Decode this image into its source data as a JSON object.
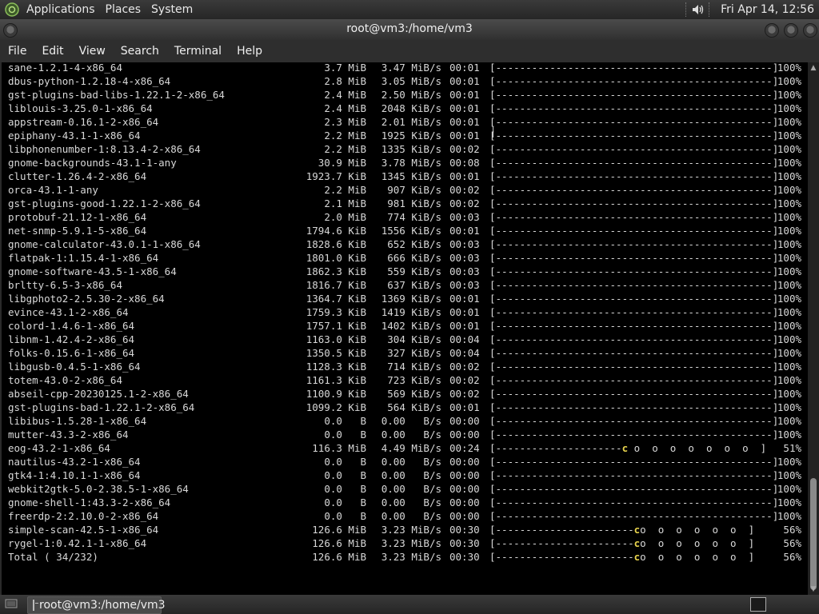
{
  "top_panel": {
    "menus": [
      "Applications",
      "Places",
      "System"
    ],
    "clock": "Fri Apr 14, 12:56"
  },
  "window": {
    "title": "root@vm3:/home/vm3",
    "menu": [
      "File",
      "Edit",
      "View",
      "Search",
      "Terminal",
      "Help"
    ]
  },
  "terminal": {
    "rows": [
      {
        "name": "sane-1.2.1-4-x86_64",
        "size": "3.7 MiB",
        "rate": "3.47 MiB/s",
        "time": "00:01",
        "bar": "[----------------------------------------------]",
        "pct": "100%"
      },
      {
        "name": "dbus-python-1.2.18-4-x86_64",
        "size": "2.8 MiB",
        "rate": "3.05 MiB/s",
        "time": "00:01",
        "bar": "[----------------------------------------------]",
        "pct": "100%"
      },
      {
        "name": "gst-plugins-bad-libs-1.22.1-2-x86_64",
        "size": "2.4 MiB",
        "rate": "2.50 MiB/s",
        "time": "00:01",
        "bar": "[----------------------------------------------]",
        "pct": "100%"
      },
      {
        "name": "liblouis-3.25.0-1-x86_64",
        "size": "2.4 MiB",
        "rate": "2048 KiB/s",
        "time": "00:01",
        "bar": "[----------------------------------------------]",
        "pct": "100%"
      },
      {
        "name": "appstream-0.16.1-2-x86_64",
        "size": "2.3 MiB",
        "rate": "2.01 MiB/s",
        "time": "00:01",
        "bar": "[----------------------------------------------]",
        "pct": "100%"
      },
      {
        "name": "epiphany-43.1-1-x86_64",
        "size": "2.2 MiB",
        "rate": "1925 KiB/s",
        "time": "00:01",
        "bar": "[----------------------------------------------]",
        "pct": "100%"
      },
      {
        "name": "libphonenumber-1:8.13.4-2-x86_64",
        "size": "2.2 MiB",
        "rate": "1335 KiB/s",
        "time": "00:02",
        "bar": "[----------------------------------------------]",
        "pct": "100%"
      },
      {
        "name": "gnome-backgrounds-43.1-1-any",
        "size": "30.9 MiB",
        "rate": "3.78 MiB/s",
        "time": "00:08",
        "bar": "[----------------------------------------------]",
        "pct": "100%"
      },
      {
        "name": "clutter-1.26.4-2-x86_64",
        "size": "1923.7 KiB",
        "rate": "1345 KiB/s",
        "time": "00:01",
        "bar": "[----------------------------------------------]",
        "pct": "100%"
      },
      {
        "name": "orca-43.1-1-any",
        "size": "2.2 MiB",
        "rate": "907 KiB/s",
        "time": "00:02",
        "bar": "[----------------------------------------------]",
        "pct": "100%"
      },
      {
        "name": "gst-plugins-good-1.22.1-2-x86_64",
        "size": "2.1 MiB",
        "rate": "981 KiB/s",
        "time": "00:02",
        "bar": "[----------------------------------------------]",
        "pct": "100%"
      },
      {
        "name": "protobuf-21.12-1-x86_64",
        "size": "2.0 MiB",
        "rate": "774 KiB/s",
        "time": "00:03",
        "bar": "[----------------------------------------------]",
        "pct": "100%"
      },
      {
        "name": "net-snmp-5.9.1-5-x86_64",
        "size": "1794.6 KiB",
        "rate": "1556 KiB/s",
        "time": "00:01",
        "bar": "[----------------------------------------------]",
        "pct": "100%"
      },
      {
        "name": "gnome-calculator-43.0.1-1-x86_64",
        "size": "1828.6 KiB",
        "rate": "652 KiB/s",
        "time": "00:03",
        "bar": "[----------------------------------------------]",
        "pct": "100%"
      },
      {
        "name": "flatpak-1:1.15.4-1-x86_64",
        "size": "1801.0 KiB",
        "rate": "666 KiB/s",
        "time": "00:03",
        "bar": "[----------------------------------------------]",
        "pct": "100%"
      },
      {
        "name": "gnome-software-43.5-1-x86_64",
        "size": "1862.3 KiB",
        "rate": "559 KiB/s",
        "time": "00:03",
        "bar": "[----------------------------------------------]",
        "pct": "100%"
      },
      {
        "name": "brltty-6.5-3-x86_64",
        "size": "1816.7 KiB",
        "rate": "637 KiB/s",
        "time": "00:03",
        "bar": "[----------------------------------------------]",
        "pct": "100%"
      },
      {
        "name": "libgphoto2-2.5.30-2-x86_64",
        "size": "1364.7 KiB",
        "rate": "1369 KiB/s",
        "time": "00:01",
        "bar": "[----------------------------------------------]",
        "pct": "100%"
      },
      {
        "name": "evince-43.1-2-x86_64",
        "size": "1759.3 KiB",
        "rate": "1419 KiB/s",
        "time": "00:01",
        "bar": "[----------------------------------------------]",
        "pct": "100%"
      },
      {
        "name": "colord-1.4.6-1-x86_64",
        "size": "1757.1 KiB",
        "rate": "1402 KiB/s",
        "time": "00:01",
        "bar": "[----------------------------------------------]",
        "pct": "100%"
      },
      {
        "name": "libnm-1.42.4-2-x86_64",
        "size": "1163.0 KiB",
        "rate": "304 KiB/s",
        "time": "00:04",
        "bar": "[----------------------------------------------]",
        "pct": "100%"
      },
      {
        "name": "folks-0.15.6-1-x86_64",
        "size": "1350.5 KiB",
        "rate": "327 KiB/s",
        "time": "00:04",
        "bar": "[----------------------------------------------]",
        "pct": "100%"
      },
      {
        "name": "libgusb-0.4.5-1-x86_64",
        "size": "1128.3 KiB",
        "rate": "714 KiB/s",
        "time": "00:02",
        "bar": "[----------------------------------------------]",
        "pct": "100%"
      },
      {
        "name": "totem-43.0-2-x86_64",
        "size": "1161.3 KiB",
        "rate": "723 KiB/s",
        "time": "00:02",
        "bar": "[----------------------------------------------]",
        "pct": "100%"
      },
      {
        "name": "abseil-cpp-20230125.1-2-x86_64",
        "size": "1100.9 KiB",
        "rate": "569 KiB/s",
        "time": "00:02",
        "bar": "[----------------------------------------------]",
        "pct": "100%"
      },
      {
        "name": "gst-plugins-bad-1.22.1-2-x86_64",
        "size": "1099.2 KiB",
        "rate": "564 KiB/s",
        "time": "00:01",
        "bar": "[----------------------------------------------]",
        "pct": "100%"
      },
      {
        "name": "libibus-1.5.28-1-x86_64",
        "size": "0.0   B",
        "rate": "0.00   B/s",
        "time": "00:00",
        "bar": "[----------------------------------------------]",
        "pct": "100%"
      },
      {
        "name": "mutter-43.3-2-x86_64",
        "size": "0.0   B",
        "rate": "0.00   B/s",
        "time": "00:00",
        "bar": "[----------------------------------------------]",
        "pct": "100%"
      },
      {
        "name": "eog-43.2-1-x86_64",
        "size": "116.3 MiB",
        "rate": "4.49 MiB/s",
        "time": "00:24",
        "bar": "[---------------------",
        "pac": "c",
        "tail": " o  o  o  o  o  o  o  ]",
        "pct": "51%"
      },
      {
        "name": "nautilus-43.2-1-x86_64",
        "size": "0.0   B",
        "rate": "0.00   B/s",
        "time": "00:00",
        "bar": "[----------------------------------------------]",
        "pct": "100%"
      },
      {
        "name": "gtk4-1:4.10.1-1-x86_64",
        "size": "0.0   B",
        "rate": "0.00   B/s",
        "time": "00:00",
        "bar": "[----------------------------------------------]",
        "pct": "100%"
      },
      {
        "name": "webkit2gtk-5.0-2.38.5-1-x86_64",
        "size": "0.0   B",
        "rate": "0.00   B/s",
        "time": "00:00",
        "bar": "[----------------------------------------------]",
        "pct": "100%"
      },
      {
        "name": "gnome-shell-1:43.3-2-x86_64",
        "size": "0.0   B",
        "rate": "0.00   B/s",
        "time": "00:00",
        "bar": "[----------------------------------------------]",
        "pct": "100%"
      },
      {
        "name": "freerdp-2:2.10.0-2-x86_64",
        "size": "0.0   B",
        "rate": "0.00   B/s",
        "time": "00:00",
        "bar": "[----------------------------------------------]",
        "pct": "100%"
      },
      {
        "name": "simple-scan-42.5-1-x86_64",
        "size": "126.6 MiB",
        "rate": "3.23 MiB/s",
        "time": "00:30",
        "bar": "[-----------------------",
        "pac": "c",
        "tail": "o  o  o  o  o  o  ]",
        "pct": "56%"
      },
      {
        "name": "rygel-1:0.42.1-1-x86_64",
        "size": "126.6 MiB",
        "rate": "3.23 MiB/s",
        "time": "00:30",
        "bar": "[-----------------------",
        "pac": "c",
        "tail": "o  o  o  o  o  o  ]",
        "pct": "56%"
      },
      {
        "name": "Total ( 34/232)",
        "size": "126.6 MiB",
        "rate": "3.23 MiB/s",
        "time": "00:30",
        "bar": "[-----------------------",
        "pac": "c",
        "tail": "o  o  o  o  o  o  ]",
        "pct": "56%"
      }
    ]
  },
  "taskbar": {
    "task_label": "root@vm3:/home/vm3"
  },
  "colors": {
    "terminal_bg": "#000000",
    "terminal_fg": "#d8d8d8",
    "pacman": "#e8d44d",
    "panel_bg": "#2e2e2e"
  }
}
